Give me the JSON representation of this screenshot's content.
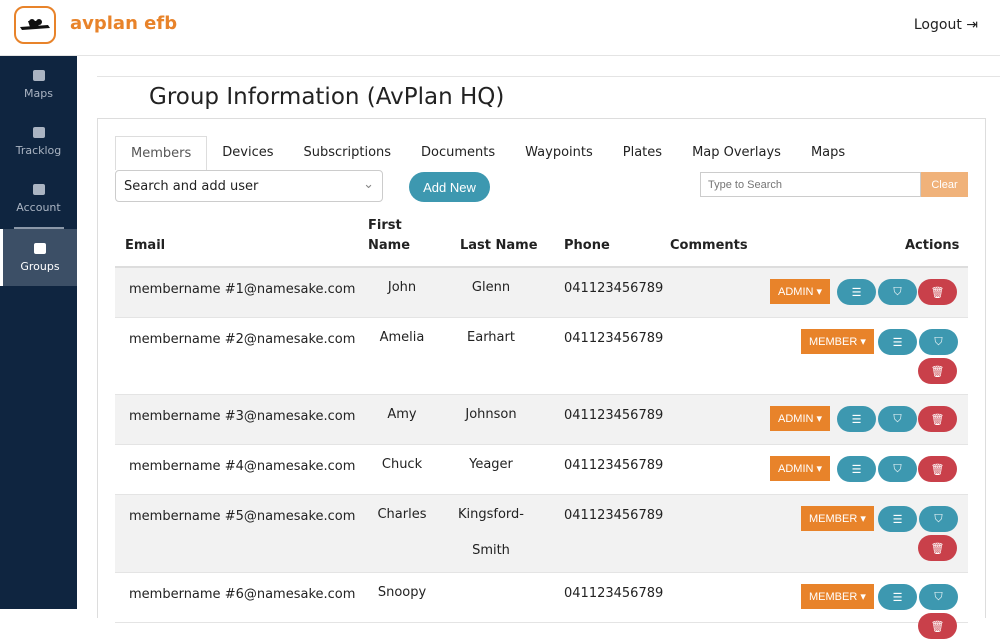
{
  "header": {
    "brand": "avplan efb",
    "logout": "Logout"
  },
  "sidebar": {
    "items": [
      {
        "label": "Maps",
        "icon": "map-icon"
      },
      {
        "label": "Tracklog",
        "icon": "route-icon"
      },
      {
        "label": "Account",
        "icon": "user-icon"
      },
      {
        "label": "Groups",
        "icon": "users-icon"
      }
    ]
  },
  "page": {
    "title": "Group Information (AvPlan HQ)"
  },
  "tabs": [
    "Members",
    "Devices",
    "Subscriptions",
    "Documents",
    "Waypoints",
    "Plates",
    "Map Overlays",
    "Maps"
  ],
  "toolbar": {
    "select_value": "Search and add user",
    "add_new": "Add New",
    "search_placeholder": "Type to Search",
    "clear": "Clear"
  },
  "table": {
    "headers": {
      "email": "Email",
      "first": "First Name",
      "last": "Last Name",
      "phone": "Phone",
      "comments": "Comments",
      "actions": "Actions"
    },
    "rows": [
      {
        "email": "membername #1@namesake.com",
        "first": "John",
        "last": "Glenn",
        "phone": "041123456789",
        "role": "ADMIN"
      },
      {
        "email": "membername #2@namesake.com",
        "first": "Amelia",
        "last": "Earhart",
        "phone": "041123456789",
        "role": "MEMBER"
      },
      {
        "email": "membername #3@namesake.com",
        "first": "Amy",
        "last": "Johnson",
        "phone": "041123456789",
        "role": "ADMIN"
      },
      {
        "email": "membername #4@namesake.com",
        "first": "Chuck",
        "last": "Yeager",
        "phone": "041123456789",
        "role": "ADMIN"
      },
      {
        "email": "membername #5@namesake.com",
        "first": "Charles",
        "last": "Kingsford-Smith",
        "phone": "041123456789",
        "role": "MEMBER"
      },
      {
        "email": "membername #6@namesake.com",
        "first": "Snoopy",
        "last": "",
        "phone": "041123456789",
        "role": "MEMBER"
      }
    ]
  }
}
